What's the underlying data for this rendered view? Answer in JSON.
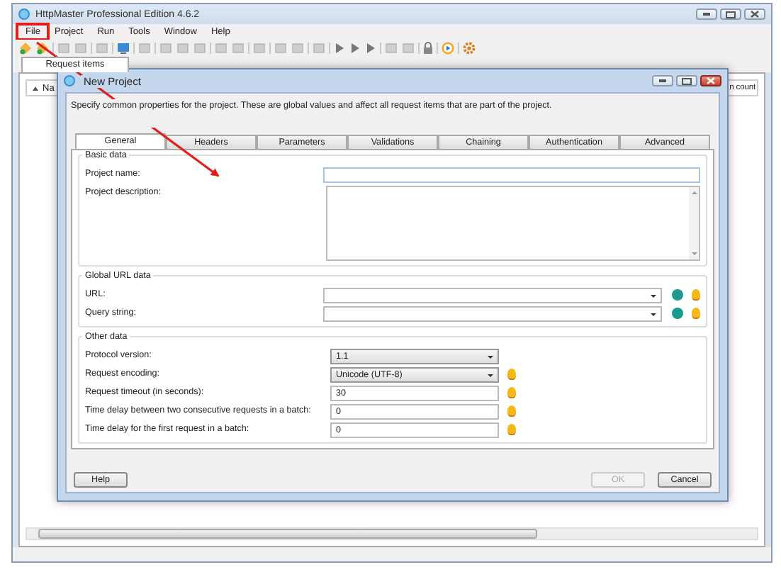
{
  "window": {
    "title": "HttpMaster Professional Edition 4.6.2"
  },
  "menu": [
    {
      "label": "File",
      "annotated": true
    },
    {
      "label": "Project",
      "annotated": false
    },
    {
      "label": "Run",
      "annotated": false
    },
    {
      "label": "Tools",
      "annotated": false
    },
    {
      "label": "Window",
      "annotated": false
    },
    {
      "label": "Help",
      "annotated": false
    }
  ],
  "document_tab": {
    "label": "Request items"
  },
  "list_columns": [
    "Na",
    "n count"
  ],
  "dialog": {
    "title": "New Project",
    "description": "Specify common properties for the project. These are global values and affect all request items that are part of the project.",
    "tabs": [
      {
        "label": "General",
        "selected": true
      },
      {
        "label": "Headers",
        "selected": false
      },
      {
        "label": "Parameters",
        "selected": false
      },
      {
        "label": "Validations",
        "selected": false
      },
      {
        "label": "Chaining",
        "selected": false
      },
      {
        "label": "Authentication",
        "selected": false
      },
      {
        "label": "Advanced",
        "selected": false
      }
    ],
    "groups": [
      {
        "title": "Basic data",
        "compact": false,
        "fields": [
          {
            "label": "Project name:",
            "kind": "text"
          },
          {
            "label": "Project description:",
            "kind": "textarea"
          }
        ]
      },
      {
        "title": "Global URL data",
        "compact": false,
        "fields": [
          {
            "label": "URL:",
            "kind": "combo",
            "hint": true
          },
          {
            "label": "Query string:",
            "kind": "combo",
            "hint": true
          }
        ]
      },
      {
        "title": "Other data",
        "compact": true,
        "fields": [
          {
            "label": "Protocol version:",
            "kind": "select",
            "value": "1.1",
            "hint": false
          },
          {
            "label": "Request encoding:",
            "kind": "select",
            "value": "Unicode (UTF-8)",
            "hint": true
          },
          {
            "label": "Request timeout (in seconds):",
            "kind": "text",
            "value": "30",
            "hint": true
          },
          {
            "label": "Time delay between two consecutive requests in a batch:",
            "kind": "text",
            "value": "0",
            "hint": true
          },
          {
            "label": "Time delay for the first request in a batch:",
            "kind": "text",
            "value": "0",
            "hint": true
          }
        ]
      }
    ],
    "buttons": [
      {
        "label": "Help",
        "disabled": false
      },
      {
        "label": "OK",
        "disabled": true
      },
      {
        "label": "Cancel",
        "disabled": false
      }
    ]
  }
}
